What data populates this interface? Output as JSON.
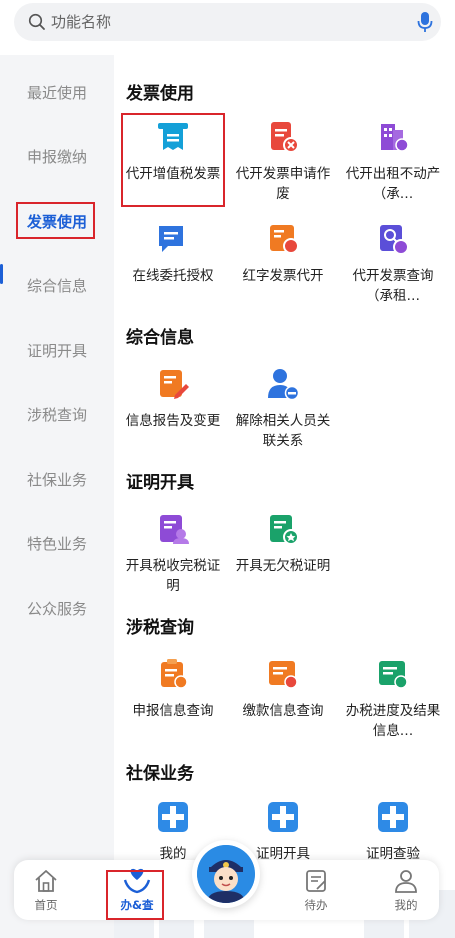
{
  "search": {
    "placeholder": "功能名称"
  },
  "sidebar": {
    "items": [
      {
        "label": "最近使用"
      },
      {
        "label": "申报缴纳"
      },
      {
        "label": "发票使用"
      },
      {
        "label": "综合信息"
      },
      {
        "label": "证明开具"
      },
      {
        "label": "涉税查询"
      },
      {
        "label": "社保业务"
      },
      {
        "label": "特色业务"
      },
      {
        "label": "公众服务"
      }
    ]
  },
  "sections": {
    "invoice": {
      "title": "发票使用",
      "items": [
        {
          "label": "代开增值税发票",
          "icon": "invoice-receipt-icon"
        },
        {
          "label": "代开发票申请作废",
          "icon": "invoice-void-icon"
        },
        {
          "label": "代开出租不动产（承…",
          "icon": "building-invoice-icon"
        },
        {
          "label": "在线委托授权",
          "icon": "authorize-chat-icon"
        },
        {
          "label": "红字发票代开",
          "icon": "red-invoice-icon"
        },
        {
          "label": "代开发票查询（承租…",
          "icon": "invoice-query-icon"
        }
      ]
    },
    "info": {
      "title": "综合信息",
      "items": [
        {
          "label": "信息报告及变更",
          "icon": "edit-report-icon"
        },
        {
          "label": "解除相关人员关联关系",
          "icon": "remove-person-icon"
        }
      ]
    },
    "certificate": {
      "title": "证明开具",
      "items": [
        {
          "label": "开具税收完税证明",
          "icon": "tax-paid-certificate-icon"
        },
        {
          "label": "开具无欠税证明",
          "icon": "no-arrears-certificate-icon"
        }
      ]
    },
    "query": {
      "title": "涉税查询",
      "items": [
        {
          "label": "申报信息查询",
          "icon": "declaration-query-icon"
        },
        {
          "label": "缴款信息查询",
          "icon": "payment-query-icon"
        },
        {
          "label": "办税进度及结果信息…",
          "icon": "progress-query-icon"
        }
      ]
    },
    "social": {
      "title": "社保业务",
      "items": [
        {
          "label": "我的",
          "icon": "social-cross-icon"
        },
        {
          "label": "证明开具",
          "icon": "social-cross-icon"
        },
        {
          "label": "证明查验",
          "icon": "social-cross-icon"
        }
      ]
    }
  },
  "tabbar": {
    "items": [
      {
        "label": "首页",
        "icon": "home-icon"
      },
      {
        "label": "办&查",
        "icon": "heart-hands-icon"
      },
      {
        "label": "待办",
        "icon": "todo-icon"
      },
      {
        "label": "我的",
        "icon": "person-icon"
      }
    ],
    "center_badge": "police-mascot-avatar"
  },
  "colors": {
    "accent": "#1c5fd6",
    "highlight": "#d9252b",
    "teal": "#14a0d8",
    "red": "#e8483c",
    "purple": "#8e4bd6",
    "orange": "#f07a22",
    "green": "#1aa26a"
  }
}
